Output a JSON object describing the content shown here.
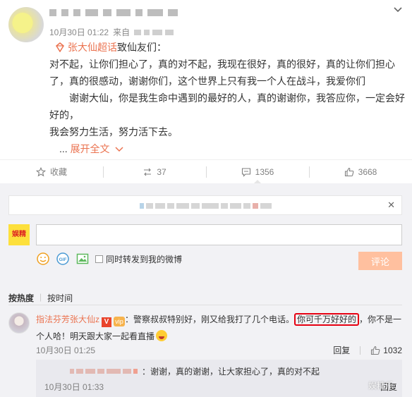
{
  "post": {
    "meta": {
      "timestamp": "10月30日 01:22",
      "source_prefix": "来自"
    },
    "topic": {
      "name": "张大仙超话",
      "suffix": "致仙友们："
    },
    "paragraphs": [
      "对不起，让你们担心了，真的对不起，我现在很好，真的很好，真的让你们担心了，真的很感动，谢谢你们，这个世界上只有我一个人在战斗，我爱你们",
      "谢谢大仙，你是我生命中遇到的最好的人，真的谢谢你，我答应你，一定会好好的，",
      "我会努力生活，努力活下去。"
    ],
    "expand": {
      "dots": "...",
      "label": "展开全文"
    },
    "actions": {
      "favorite": "收藏",
      "repost": "37",
      "comment": "1356",
      "like": "3668"
    }
  },
  "composer": {
    "avatar_text": "娱精",
    "sync_label": "同时转发到我的微博",
    "submit_label": "评论"
  },
  "sort": {
    "hot": "按热度",
    "time": "按时间"
  },
  "comment": {
    "username": "指法芬芳张大仙z",
    "badge": "V",
    "vip": "vip",
    "text_before": "：警察叔叔特别好，刚又给我打了几个电话。",
    "text_highlight": "你可千万好好的",
    "text_after": "，你不是一个人哈！明天跟大家一起看直播",
    "time": "10月30日 01:25",
    "reply_label": "回复",
    "like_count": "1032"
  },
  "reply": {
    "text": "：谢谢，真的谢谢，让大家担心了，真的对不起",
    "time": "10月30日 01:33",
    "reply_label": "回复"
  },
  "watermark": "娱精乐",
  "colors": {
    "accent": "#eb7350",
    "highlight": "#e60012",
    "submit_bg": "#ffc09f",
    "comment_bg": "#f2f2f5"
  }
}
